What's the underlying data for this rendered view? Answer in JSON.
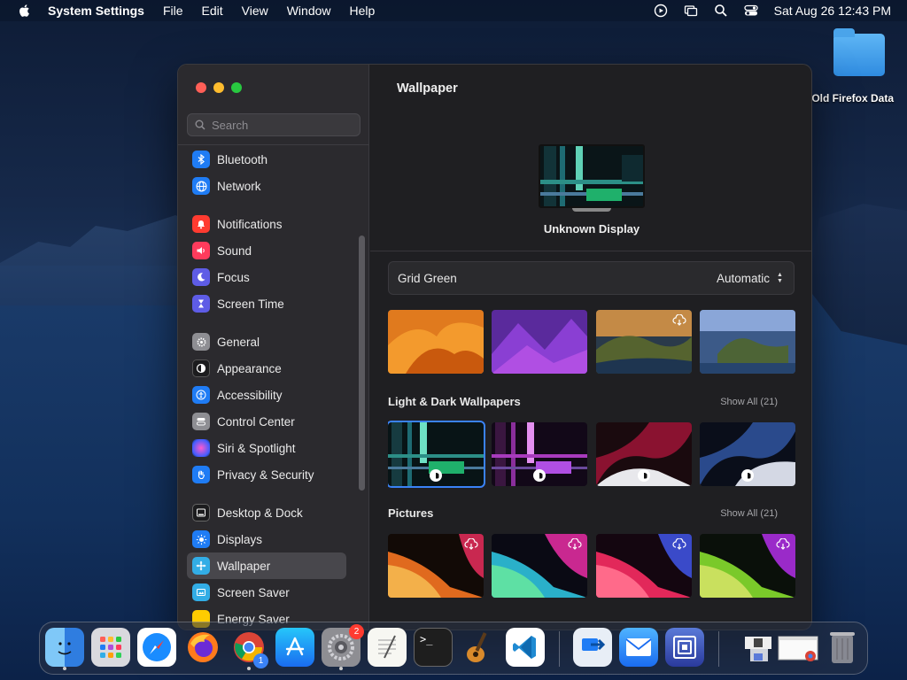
{
  "menubar": {
    "app_name": "System Settings",
    "items": [
      "File",
      "Edit",
      "View",
      "Window",
      "Help"
    ],
    "datetime": "Sat Aug 26  12:43 PM"
  },
  "desktop": {
    "folder_label": "Old Firefox Data"
  },
  "sidebar": {
    "search_placeholder": "Search",
    "items": [
      {
        "label": "Bluetooth",
        "icon": "bluetooth-icon",
        "color": "#1f7cf5"
      },
      {
        "label": "Network",
        "icon": "globe-icon",
        "color": "#1f7cf5"
      },
      {
        "label": "Notifications",
        "icon": "bell-icon",
        "color": "#ff3b30"
      },
      {
        "label": "Sound",
        "icon": "speaker-icon",
        "color": "#ff3b5c"
      },
      {
        "label": "Focus",
        "icon": "moon-icon",
        "color": "#5e5ce6"
      },
      {
        "label": "Screen Time",
        "icon": "hourglass-icon",
        "color": "#5e5ce6"
      },
      {
        "label": "General",
        "icon": "gear-icon",
        "color": "#8e8e93"
      },
      {
        "label": "Appearance",
        "icon": "appearance-icon",
        "color": "#1c1c1e"
      },
      {
        "label": "Accessibility",
        "icon": "accessibility-icon",
        "color": "#1f7cf5"
      },
      {
        "label": "Control Center",
        "icon": "control-center-icon",
        "color": "#8e8e93"
      },
      {
        "label": "Siri & Spotlight",
        "icon": "siri-icon",
        "color": "#b04dd8"
      },
      {
        "label": "Privacy & Security",
        "icon": "hand-icon",
        "color": "#1f7cf5"
      },
      {
        "label": "Desktop & Dock",
        "icon": "dock-icon",
        "color": "#1c1c1e"
      },
      {
        "label": "Displays",
        "icon": "sun-icon",
        "color": "#1f7cf5"
      },
      {
        "label": "Wallpaper",
        "icon": "wallpaper-icon",
        "color": "#32ade6"
      },
      {
        "label": "Screen Saver",
        "icon": "screensaver-icon",
        "color": "#32ade6"
      },
      {
        "label": "Energy Saver",
        "icon": "bulb-icon",
        "color": "#ffcc00"
      }
    ],
    "selected": "Wallpaper"
  },
  "content": {
    "title": "Wallpaper",
    "display_name": "Unknown Display",
    "wallpaper_name": "Grid Green",
    "mode": "Automatic",
    "sections": [
      {
        "title": "Light & Dark Wallpapers",
        "show_all": "Show All (21)"
      },
      {
        "title": "Pictures",
        "show_all": "Show All (21)"
      }
    ]
  },
  "dock": {
    "apps": [
      {
        "name": "Finder",
        "icon": "finder-icon"
      },
      {
        "name": "Launchpad",
        "icon": "launchpad-icon"
      },
      {
        "name": "Safari",
        "icon": "safari-icon"
      },
      {
        "name": "Firefox",
        "icon": "firefox-icon"
      },
      {
        "name": "Chrome",
        "icon": "chrome-icon",
        "badge": "1"
      },
      {
        "name": "App Store",
        "icon": "appstore-icon"
      },
      {
        "name": "System Settings",
        "icon": "settings-icon",
        "badge": "2"
      },
      {
        "name": "TextEdit",
        "icon": "textedit-icon"
      },
      {
        "name": "Terminal",
        "icon": "terminal-icon"
      },
      {
        "name": "GarageBand",
        "icon": "guitar-icon"
      },
      {
        "name": "VS Code",
        "icon": "vscode-icon"
      },
      {
        "name": "Migration Assistant",
        "icon": "migration-icon"
      },
      {
        "name": "Mail",
        "icon": "mail-icon"
      },
      {
        "name": "Screen Sharing",
        "icon": "screensharing-icon"
      },
      {
        "name": "Downloads",
        "icon": "downloads-stack-icon"
      },
      {
        "name": "Chrome Window",
        "icon": "window-preview-icon"
      },
      {
        "name": "Trash",
        "icon": "trash-icon"
      }
    ]
  }
}
